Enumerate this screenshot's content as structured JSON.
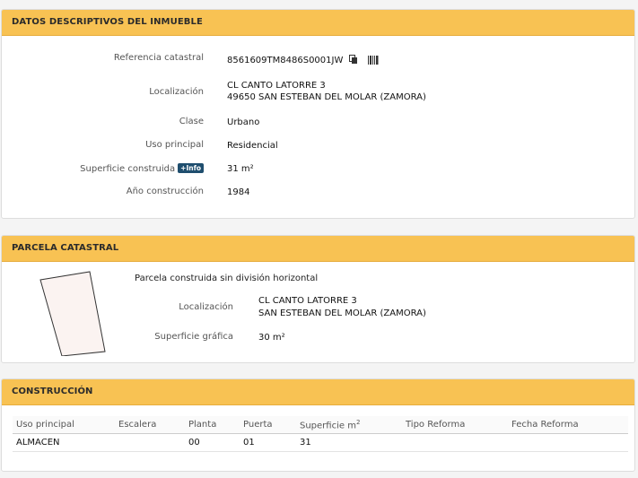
{
  "inmueble": {
    "title": "DATOS DESCRIPTIVOS DEL INMUEBLE",
    "fields": [
      {
        "label": "Referencia catastral",
        "value": "8561609TM8486S0001JW"
      },
      {
        "label": "Localización",
        "value": "CL CANTO LATORRE 3",
        "value2": "49650 SAN ESTEBAN DEL MOLAR (ZAMORA)"
      },
      {
        "label": "Clase",
        "value": "Urbano"
      },
      {
        "label": "Uso principal",
        "value": "Residencial"
      },
      {
        "label": "Superficie construida",
        "badge": "+Info",
        "value": "31 m²"
      },
      {
        "label": "Año construcción",
        "value": "1984"
      }
    ],
    "icons": [
      "copy-icon",
      "barcode-icon"
    ]
  },
  "parcela": {
    "title": "PARCELA CATASTRAL",
    "description": "Parcela construida sin división horizontal",
    "fields": [
      {
        "label": "Localización",
        "value": "CL CANTO LATORRE 3",
        "value2": "SAN ESTEBAN DEL MOLAR (ZAMORA)"
      },
      {
        "label": "Superficie gráfica",
        "value": "30 m²"
      }
    ]
  },
  "construccion": {
    "title": "CONSTRUCCIÓN",
    "columns": [
      "Uso principal",
      "Escalera",
      "Planta",
      "Puerta",
      "Superficie m",
      "Tipo Reforma",
      "Fecha Reforma"
    ],
    "superscript": "2",
    "rows": [
      [
        "ALMACEN",
        "",
        "00",
        "01",
        "31",
        "",
        ""
      ]
    ]
  }
}
